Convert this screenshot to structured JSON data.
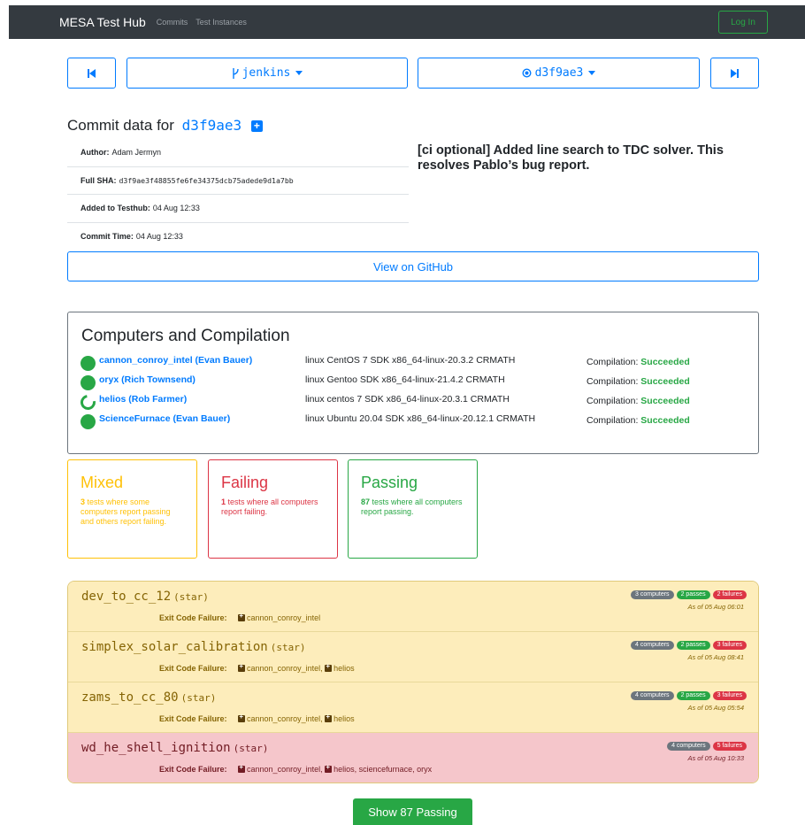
{
  "navbar": {
    "brand": "MESA Test Hub",
    "links": [
      "Commits",
      "Test Instances"
    ],
    "login": "Log In"
  },
  "selector": {
    "prev_icon": "skip-backward-icon",
    "branch_icon": "branch-icon",
    "branch": "jenkins",
    "commit_icon": "commit-icon",
    "commit": "d3f9ae3",
    "next_icon": "skip-forward-icon"
  },
  "commit": {
    "heading": "Commit data for",
    "sha_short": "d3f9ae3",
    "author_label": "Author:",
    "author": "Adam Jermyn",
    "full_sha_label": "Full SHA:",
    "full_sha": "d3f9ae3f48855fe6fe34375dcb75adede9d1a7bb",
    "added_label": "Added to Testhub:",
    "added": "04 Aug 12:33",
    "time_label": "Commit Time:",
    "time": "04 Aug 12:33",
    "message": "[ci optional] Added line search to TDC solver. This resolves Pablo’s bug report.",
    "github": "View on GitHub"
  },
  "computers": {
    "title": "Computers and Compilation",
    "rows": [
      {
        "name": "cannon_conroy_intel",
        "user": "(Evan Bauer)",
        "spec": "linux CentOS 7 SDK x86_64-linux-20.3.2 CRMATH",
        "label": "Compilation:",
        "status": "Succeeded",
        "icon": "filled"
      },
      {
        "name": "oryx",
        "user": "(Rich Townsend)",
        "spec": "linux Gentoo SDK x86_64-linux-21.4.2 CRMATH",
        "label": "Compilation:",
        "status": "Succeeded",
        "icon": "filled"
      },
      {
        "name": "helios",
        "user": "(Rob Farmer)",
        "spec": "linux centos 7 SDK x86_64-linux-20.3.1 CRMATH",
        "label": "Compilation:",
        "status": "Succeeded",
        "icon": "ring"
      },
      {
        "name": "ScienceFurnace",
        "user": "(Evan Bauer)",
        "spec": "linux Ubuntu 20.04 SDK x86_64-linux-20.12.1 CRMATH",
        "label": "Compilation:",
        "status": "Succeeded",
        "icon": "filled"
      }
    ]
  },
  "summary": {
    "mixed": {
      "title": "Mixed",
      "count": "3",
      "text": " tests where some computers report passing and others report failing."
    },
    "failing": {
      "title": "Failing",
      "count": "1",
      "text": " tests where all computers report failing."
    },
    "passing": {
      "title": "Passing",
      "count": "87",
      "text": " tests where all computers report passing."
    }
  },
  "tests": [
    {
      "name": "dev_to_cc_12",
      "tag": "(star)",
      "badges": [
        "3 computers",
        "2 passes",
        "2 failures"
      ],
      "asof": "As of 05 Aug 06:01",
      "fail_label": "Exit Code Failure:",
      "fails": [
        "cannon_conroy_intel"
      ],
      "extra": ""
    },
    {
      "name": "simplex_solar_calibration",
      "tag": "(star)",
      "badges": [
        "4 computers",
        "2 passes",
        "3 failures"
      ],
      "asof": "As of 05 Aug 08:41",
      "fail_label": "Exit Code Failure:",
      "fails": [
        "cannon_conroy_intel,",
        "helios"
      ],
      "extra": ""
    },
    {
      "name": "zams_to_cc_80",
      "tag": "(star)",
      "badges": [
        "4 computers",
        "2 passes",
        "3 failures"
      ],
      "asof": "As of 05 Aug 05:54",
      "fail_label": "Exit Code Failure:",
      "fails": [
        "cannon_conroy_intel,",
        "helios"
      ],
      "extra": ""
    },
    {
      "name": "wd_he_shell_ignition",
      "tag": "(star)",
      "badges": [
        "4 computers",
        "5 failures"
      ],
      "asof": "As of 05 Aug 10:33",
      "fail_label": "Exit Code Failure:",
      "fails": [
        "cannon_conroy_intel,",
        "helios, sciencefurnace, oryx"
      ],
      "extra": ""
    }
  ],
  "show_passing": "Show 87 Passing",
  "colors": {
    "primary": "#007bff",
    "success": "#28a745",
    "warning": "#ffc107",
    "danger": "#dc3545",
    "dark": "#343a40"
  }
}
